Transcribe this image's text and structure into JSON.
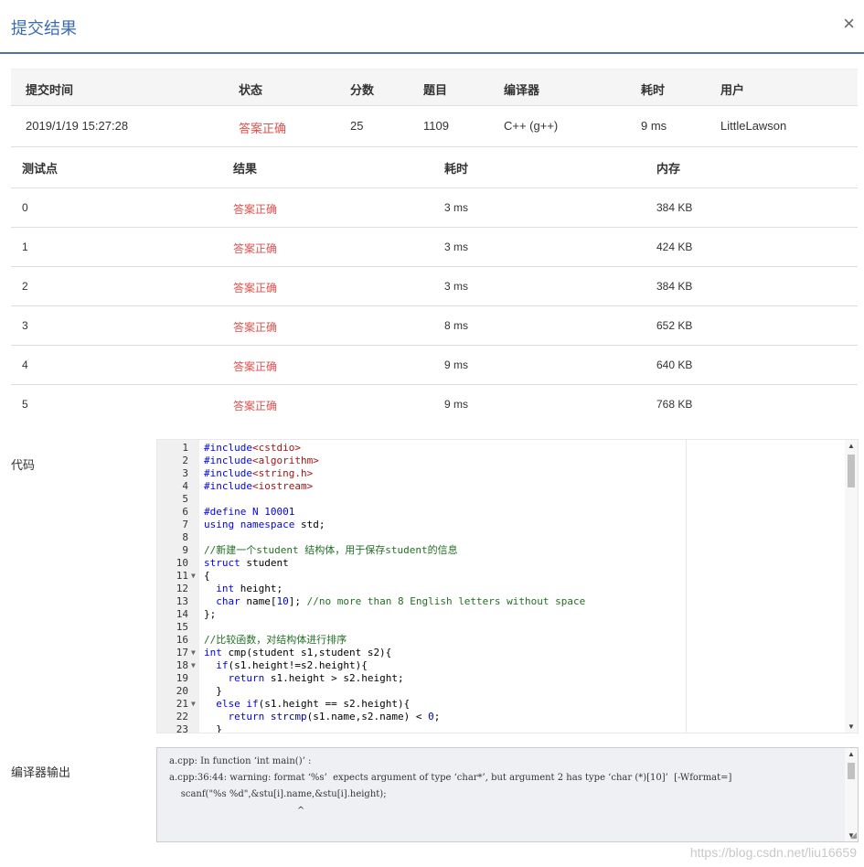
{
  "header": {
    "title": "提交结果",
    "close_glyph": "×"
  },
  "summary": {
    "headers": [
      "提交时间",
      "状态",
      "分数",
      "题目",
      "编译器",
      "耗时",
      "用户"
    ],
    "row": [
      "2019/1/19 15:27:28",
      "答案正确",
      "25",
      "1109",
      "C++ (g++)",
      "9 ms",
      "LittleLawson"
    ]
  },
  "tests": {
    "headers": [
      "测试点",
      "结果",
      "耗时",
      "内存"
    ],
    "rows": [
      [
        "0",
        "答案正确",
        "3 ms",
        "384 KB"
      ],
      [
        "1",
        "答案正确",
        "3 ms",
        "424 KB"
      ],
      [
        "2",
        "答案正确",
        "3 ms",
        "384 KB"
      ],
      [
        "3",
        "答案正确",
        "8 ms",
        "652 KB"
      ],
      [
        "4",
        "答案正确",
        "9 ms",
        "640 KB"
      ],
      [
        "5",
        "答案正确",
        "9 ms",
        "768 KB"
      ]
    ]
  },
  "code": {
    "label": "代码",
    "lines": [
      {
        "n": "1",
        "t": "#include<cstdio>"
      },
      {
        "n": "2",
        "t": "#include<algorithm>"
      },
      {
        "n": "3",
        "t": "#include<string.h>"
      },
      {
        "n": "4",
        "t": "#include<iostream>"
      },
      {
        "n": "5",
        "t": ""
      },
      {
        "n": "6",
        "t": "#define N 10001"
      },
      {
        "n": "7",
        "t": "using namespace std;"
      },
      {
        "n": "8",
        "t": ""
      },
      {
        "n": "9",
        "t": "//新建一个student 结构体，用于保存student的信息"
      },
      {
        "n": "10",
        "t": "struct student"
      },
      {
        "n": "11",
        "t": "{",
        "fold": true
      },
      {
        "n": "12",
        "t": "  int height;"
      },
      {
        "n": "13",
        "t": "  char name[10]; //no more than 8 English letters without space"
      },
      {
        "n": "14",
        "t": "};"
      },
      {
        "n": "15",
        "t": ""
      },
      {
        "n": "16",
        "t": "//比较函数，对结构体进行排序"
      },
      {
        "n": "17",
        "t": "int cmp(student s1,student s2){",
        "fold": true
      },
      {
        "n": "18",
        "t": "  if(s1.height!=s2.height){",
        "fold": true
      },
      {
        "n": "19",
        "t": "    return s1.height > s2.height;"
      },
      {
        "n": "20",
        "t": "  }"
      },
      {
        "n": "21",
        "t": "  else if(s1.height == s2.height){",
        "fold": true
      },
      {
        "n": "22",
        "t": "    return strcmp(s1.name,s2.name) < 0;"
      },
      {
        "n": "23",
        "t": "  }"
      }
    ]
  },
  "compiler_output": {
    "label": "编译器输出",
    "lines": [
      "a.cpp: In function ‘int main()’ :",
      "a.cpp:36:44: warning: format ‘%s’  expects argument of type ‘char*’, but argument 2 has type ‘char (*)[10]’  [-Wformat=]",
      "    scanf(\"%s %d\",&stu[i].name,&stu[i].height);",
      "                                            ^"
    ]
  },
  "watermark": "https://blog.csdn.net/liu16659",
  "colors": {
    "accent": "#3c6bb5",
    "success": "#d9534f"
  }
}
